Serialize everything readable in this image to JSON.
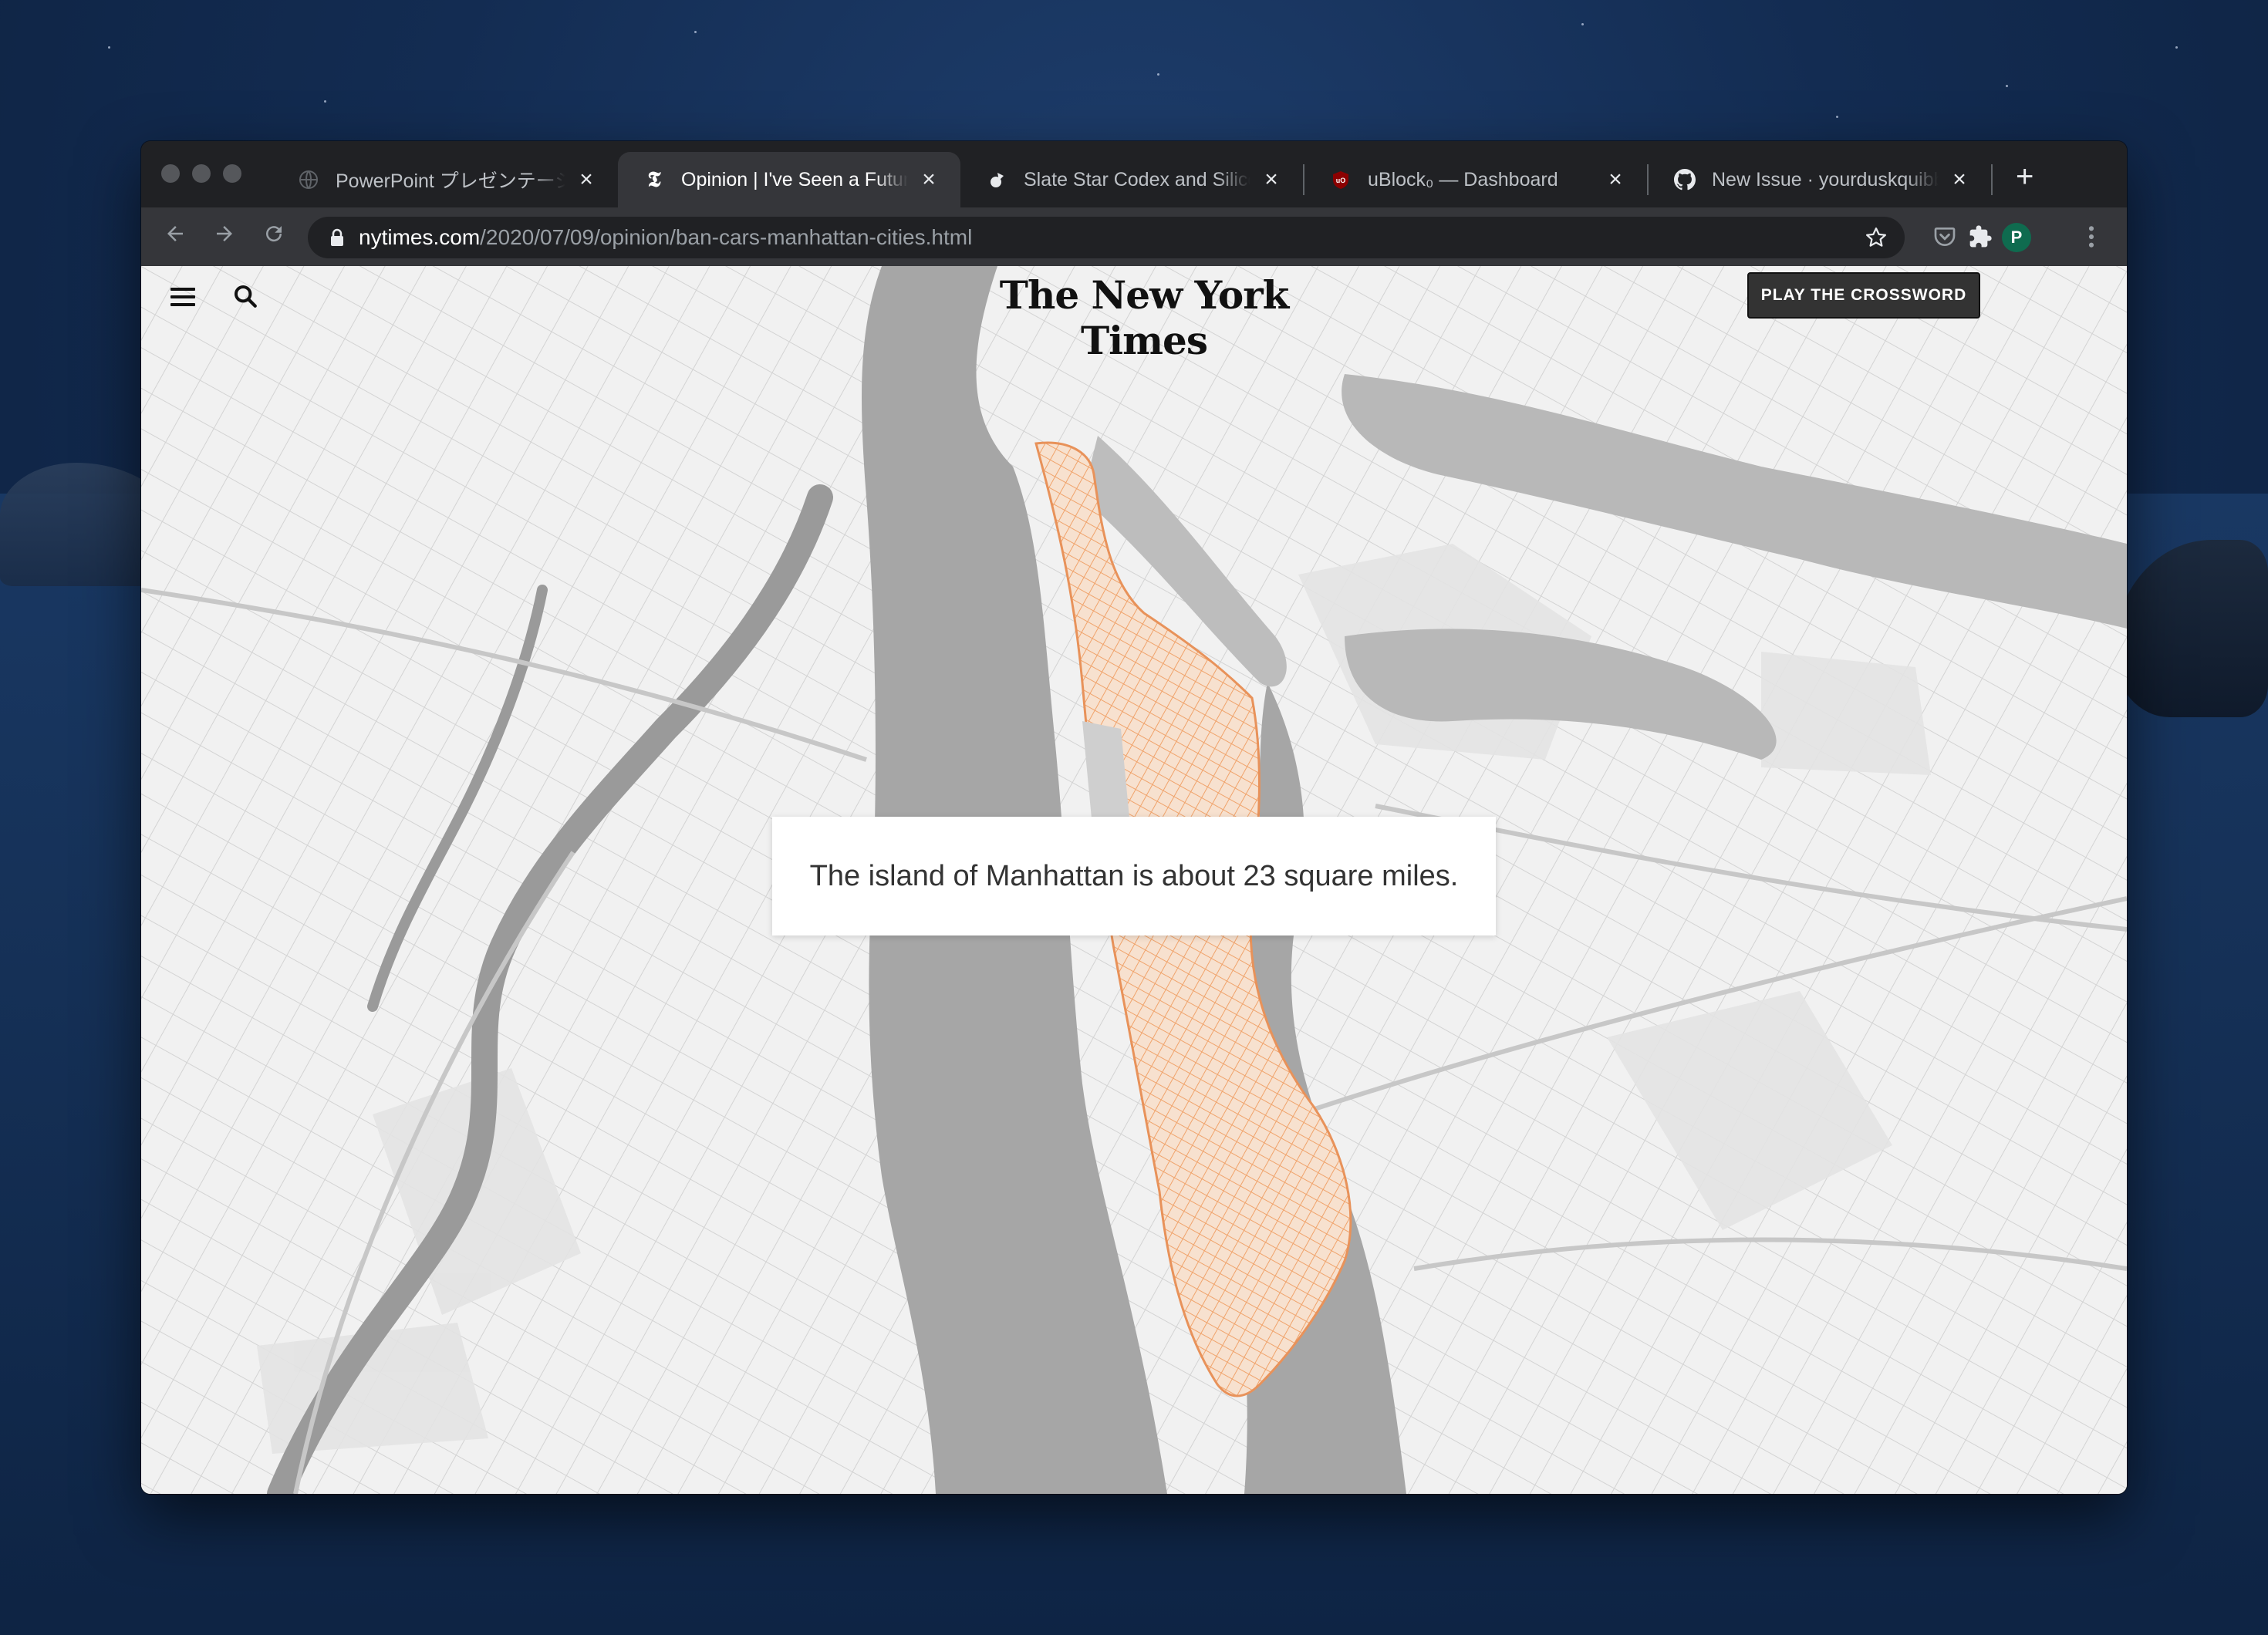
{
  "browser": {
    "tabs": [
      {
        "title": "PowerPoint プレゼンテーション",
        "favicon": "globe-icon",
        "active": false
      },
      {
        "title": "Opinion | I've Seen a Future Without Cars",
        "favicon": "nyt-t-icon",
        "active": true
      },
      {
        "title": "Slate Star Codex and Silicon Valley",
        "favicon": "ssc-icon",
        "active": false
      },
      {
        "title": "uBlock₀ — Dashboard",
        "favicon": "ublock-icon",
        "active": false
      },
      {
        "title": "New Issue · yourduskquibble",
        "favicon": "github-icon",
        "active": false
      }
    ],
    "new_tab_label": "+",
    "url_host": "nytimes.com",
    "url_path": "/2020/07/09/opinion/ban-cars-manhattan-cities.html",
    "profile_initial": "P",
    "profile_color": "#0f6b4f"
  },
  "page": {
    "logo": "The New York Times",
    "crossword_button": "PLAY THE CROSSWORD",
    "caption": "The island of Manhattan is about 23 square miles.",
    "highlight_color": "#f0a36b"
  }
}
